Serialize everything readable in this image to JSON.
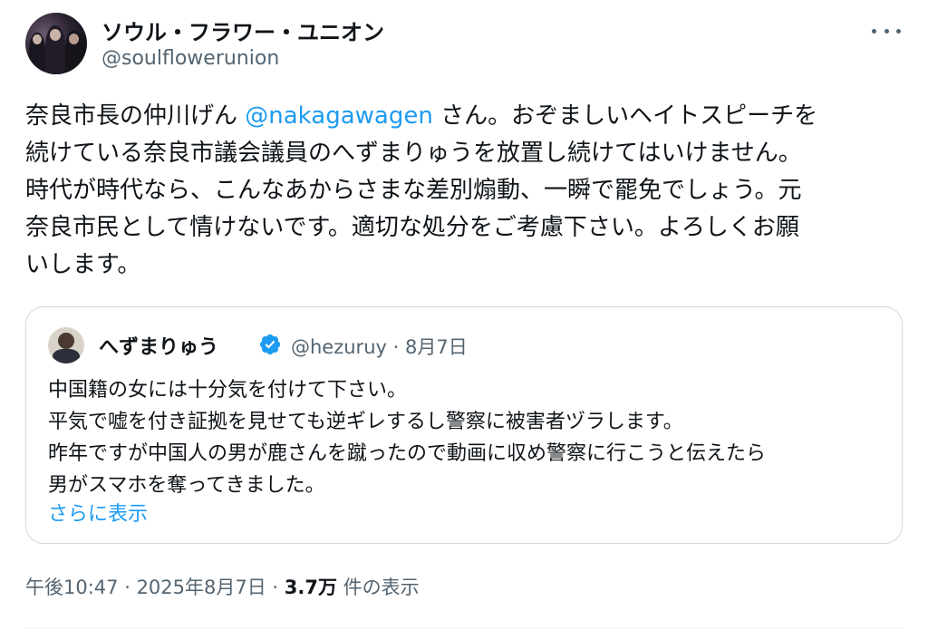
{
  "author": {
    "display_name": "ソウル・フラワー・ユニオン",
    "handle": "@soulflowerunion",
    "avatar_icon": "band-photo-avatar"
  },
  "menu": {
    "icon": "more-icon"
  },
  "tweet": {
    "line1_a": "奈良市長の仲川げん ",
    "mention": "@nakagawagen",
    "line1_b": " さん。おぞましいヘイトスピーチを",
    "line2": "続けている奈良市議会議員のへずまりゅうを放置し続けてはいけません。",
    "line3": "時代が時代なら、こんなあからさまな差別煽動、一瞬で罷免でしょう。元",
    "line4": "奈良市民として情けないです。適切な処分をご考慮下さい。よろしくお願",
    "line5": "いします。"
  },
  "quote": {
    "display_name": "へずまりゅう",
    "verified_icon": "verified-badge-icon",
    "handle": "@hezuruy",
    "separator": " · ",
    "date": "8月7日",
    "lines": [
      "中国籍の女には十分気を付けて下さい。",
      "平気で嘘を付き証拠を見せても逆ギレするし警察に被害者ヅラします。",
      "昨年ですが中国人の男が鹿さんを蹴ったので動画に収め警察に行こうと伝えたら",
      "男がスマホを奪ってきました。"
    ],
    "show_more": "さらに表示"
  },
  "footer": {
    "time": "午後10:47",
    "sep1": " · ",
    "date": "2025年8月7日",
    "sep2": " · ",
    "views": "3.7万",
    "views_label": " 件の表示"
  },
  "colors": {
    "text": "#0f1419",
    "secondary": "#536471",
    "link": "#1d9bf0",
    "border": "#cfd9de"
  }
}
